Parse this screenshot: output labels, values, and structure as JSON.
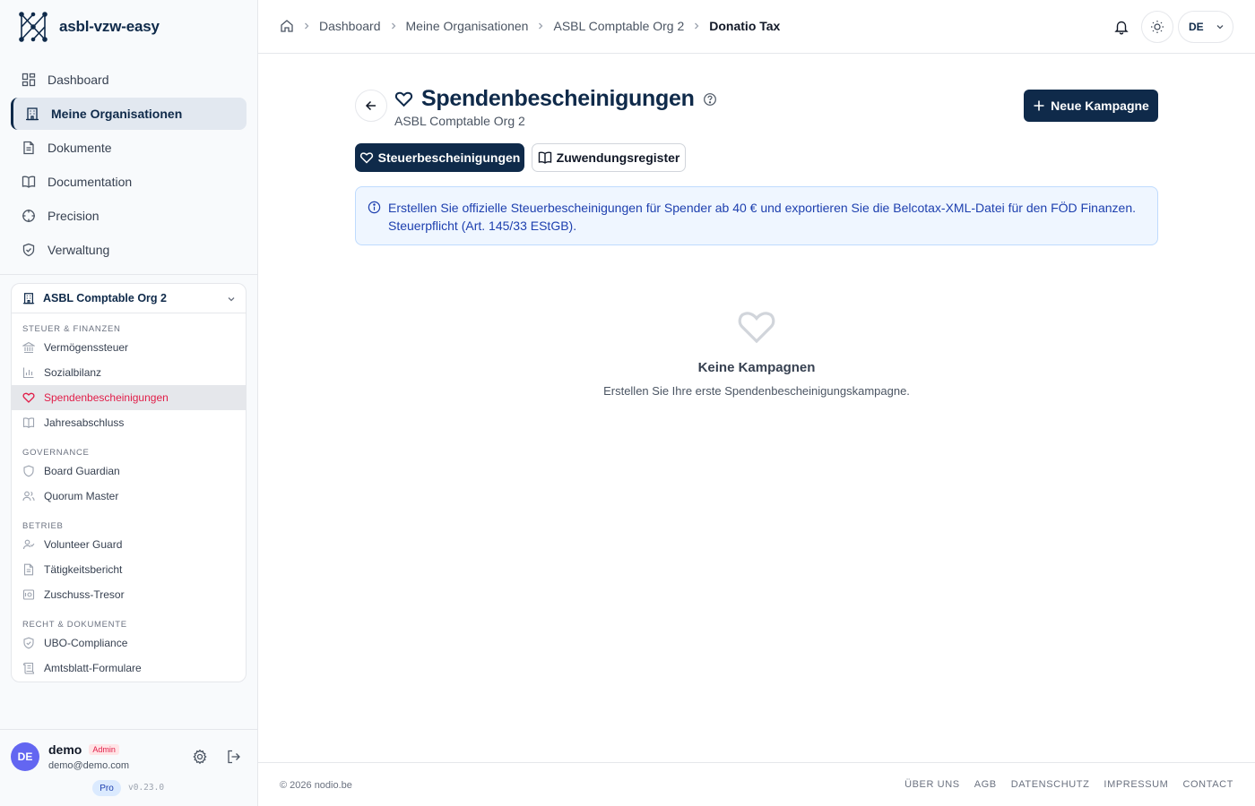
{
  "app": {
    "name": "asbl-vzw-easy"
  },
  "nav": {
    "items": [
      {
        "label": "Dashboard",
        "icon": "dashboard-icon"
      },
      {
        "label": "Meine Organisationen",
        "icon": "building-icon",
        "active": true
      },
      {
        "label": "Dokumente",
        "icon": "document-icon"
      },
      {
        "label": "Documentation",
        "icon": "book-icon"
      },
      {
        "label": "Precision",
        "icon": "crosshair-icon"
      },
      {
        "label": "Verwaltung",
        "icon": "shield-icon"
      }
    ]
  },
  "org": {
    "name": "ASBL Comptable Org 2",
    "groups": [
      {
        "title": "STEUER & FINANZEN",
        "items": [
          "Vermögenssteuer",
          "Sozialbilanz",
          "Spendenbescheinigungen",
          "Jahresabschluss"
        ]
      },
      {
        "title": "GOVERNANCE",
        "items": [
          "Board Guardian",
          "Quorum Master"
        ]
      },
      {
        "title": "BETRIEB",
        "items": [
          "Volunteer Guard",
          "Tätigkeitsbericht",
          "Zuschuss-Tresor"
        ]
      },
      {
        "title": "RECHT & DOKUMENTE",
        "items": [
          "UBO-Compliance",
          "Amtsblatt-Formulare"
        ]
      }
    ]
  },
  "user": {
    "initials": "DE",
    "name": "demo",
    "role": "Admin",
    "email": "demo@demo.com",
    "plan": "Pro",
    "version": "v0.23.0"
  },
  "breadcrumb": [
    "Dashboard",
    "Meine Organisationen",
    "ASBL Comptable Org 2",
    "Donatio Tax"
  ],
  "topbar": {
    "lang": "DE"
  },
  "page": {
    "title": "Spendenbescheinigungen",
    "subtitle": "ASBL Comptable Org 2",
    "primary_action": "Neue Kampagne",
    "tabs": [
      "Steuerbescheinigungen",
      "Zuwendungsregister"
    ],
    "info": "Erstellen Sie offizielle Steuerbescheinigungen für Spender ab 40 € und exportieren Sie die Belcotax-XML-Datei für den FÖD Finanzen. Steuerpflicht (Art. 145/33 EStGB).",
    "empty_title": "Keine Kampagnen",
    "empty_text": "Erstellen Sie Ihre erste Spendenbescheinigungskampagne."
  },
  "footer": {
    "copyright": "© 2026 nodio.be",
    "links": [
      "ÜBER UNS",
      "AGB",
      "DATENSCHUTZ",
      "IMPRESSUM",
      "CONTACT"
    ]
  },
  "colors": {
    "primary": "#0f2a4a",
    "accent_red": "#e11d48",
    "info_bg": "#eff6ff",
    "info_text": "#1e40af",
    "avatar": "#6366f1"
  }
}
